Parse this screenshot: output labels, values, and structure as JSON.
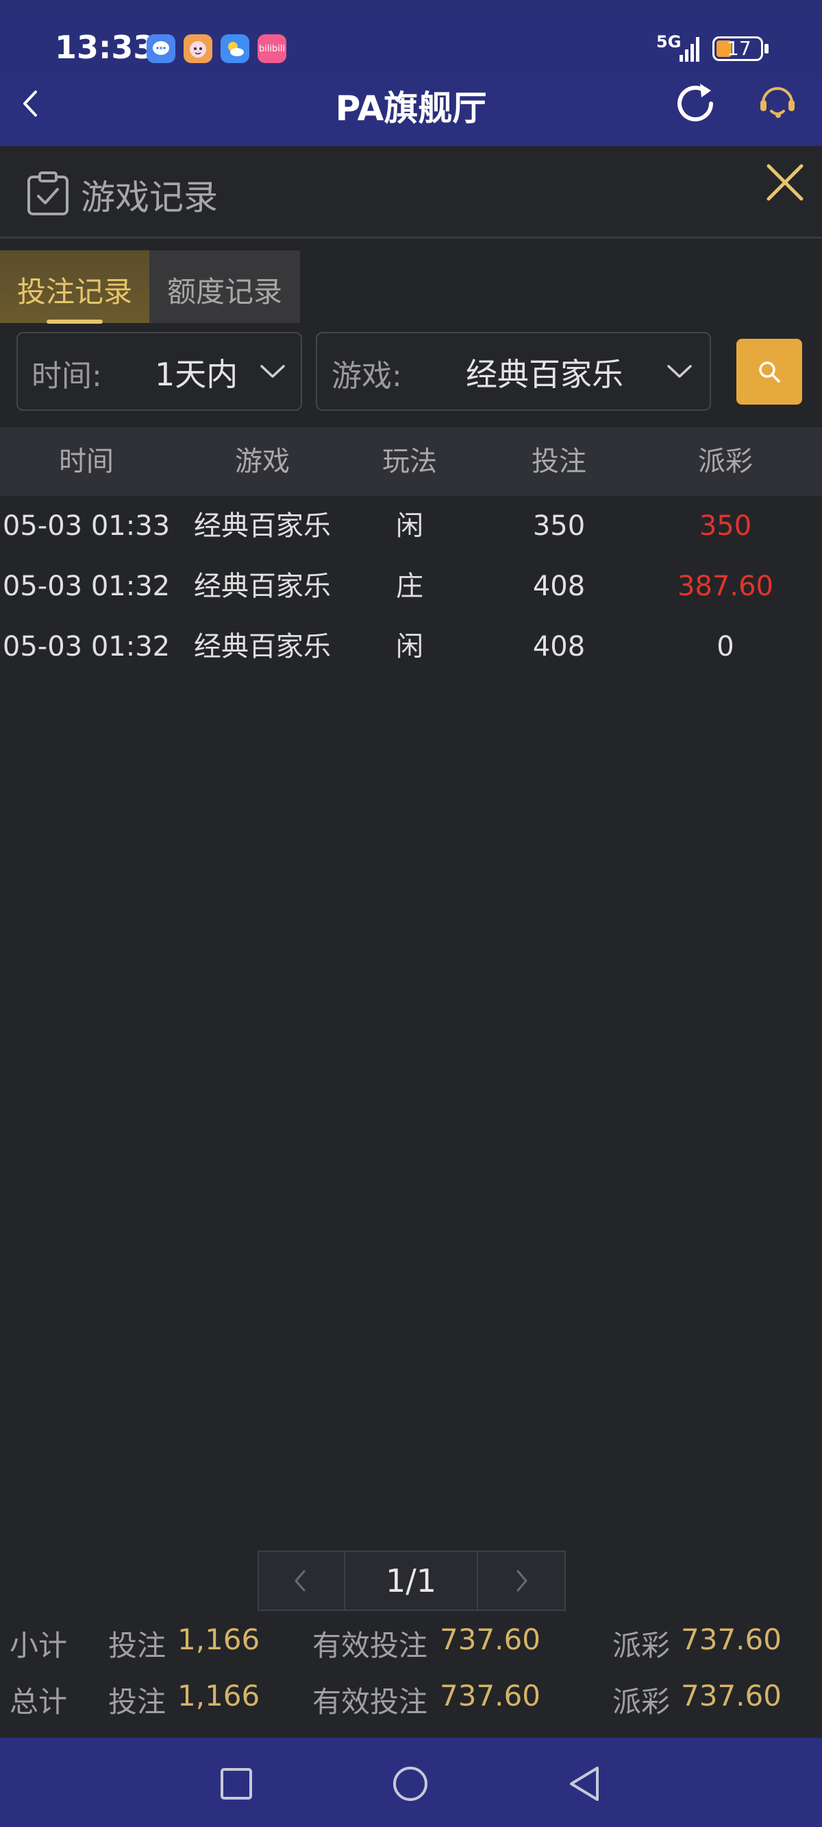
{
  "status_bar": {
    "time": "13:33",
    "app_icons": [
      "message-app-icon",
      "avatar-app-icon",
      "weather-app-icon",
      "bilibili-app-icon"
    ],
    "bilibili_text": "bilibili",
    "network": "5G",
    "battery": "17"
  },
  "nav": {
    "title": "PA旗舰厅"
  },
  "record": {
    "title": "游戏记录"
  },
  "tabs": [
    {
      "label": "投注记录",
      "active": true
    },
    {
      "label": "额度记录",
      "active": false
    }
  ],
  "filters": {
    "time_label": "时间:",
    "time_value": "1天内",
    "game_label": "游戏:",
    "game_value": "经典百家乐"
  },
  "table": {
    "headers": [
      "时间",
      "游戏",
      "玩法",
      "投注",
      "派彩"
    ],
    "rows": [
      {
        "time": "05-03 01:33",
        "game": "经典百家乐",
        "play": "闲",
        "bet": "350",
        "payout": "350",
        "highlight": true
      },
      {
        "time": "05-03 01:32",
        "game": "经典百家乐",
        "play": "庄",
        "bet": "408",
        "payout": "387.60",
        "highlight": true
      },
      {
        "time": "05-03 01:32",
        "game": "经典百家乐",
        "play": "闲",
        "bet": "408",
        "payout": "0",
        "highlight": false
      }
    ]
  },
  "pagination": {
    "page": "1/1"
  },
  "summary": {
    "subtotal": {
      "label": "小计",
      "bet_label": "投注",
      "bet": "1,166",
      "valid_label": "有效投注",
      "valid": "737.60",
      "payout_label": "派彩",
      "payout": "737.60"
    },
    "total": {
      "label": "总计",
      "bet_label": "投注",
      "bet": "1,166",
      "valid_label": "有效投注",
      "valid": "737.60",
      "payout_label": "派彩",
      "payout": "737.60"
    }
  },
  "colors": {
    "accent": "#e6a93d",
    "win_red": "#e2342a",
    "summary_gold": "#d4b468",
    "header_blue": "#2b2f80"
  }
}
